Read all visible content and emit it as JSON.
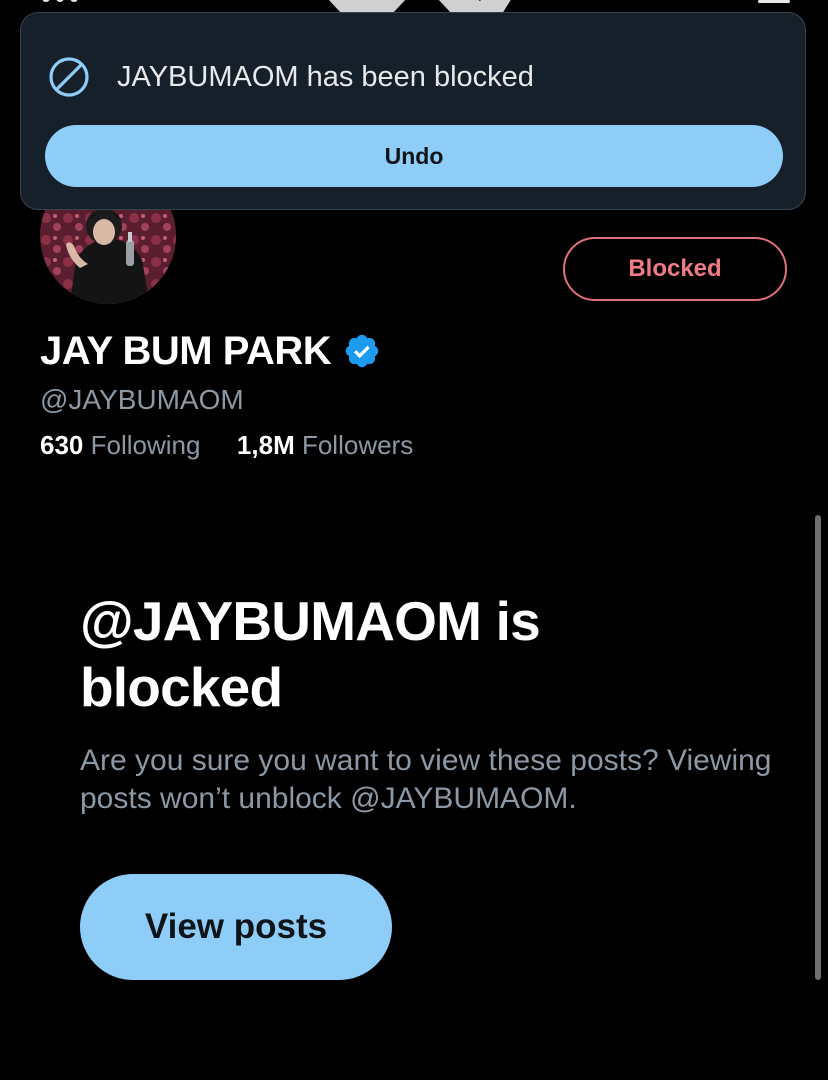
{
  "toast": {
    "icon": "block-icon",
    "message": "JAYBUMAOM has been blocked",
    "undo_label": "Undo"
  },
  "header": {
    "logo": "x-logo-icon",
    "menu_icon": "menu-icon"
  },
  "profile": {
    "avatar": "avatar",
    "blocked_button_label": "Blocked",
    "display_name": "JAY BUM PARK",
    "verified": true,
    "handle": "@JAYBUMAOM",
    "following_count": "630",
    "following_label": "Following",
    "followers_count": "1,8M",
    "followers_label": "Followers"
  },
  "blocked_notice": {
    "title": "@JAYBUMAOM is blocked",
    "description": "Are you sure you want to view these posts? Viewing posts won’t unblock @JAYBUMAOM.",
    "view_posts_label": "View posts"
  },
  "colors": {
    "background": "#000000",
    "toast_background": "#15202b",
    "accent_button": "#8ecdf8",
    "blocked_red": "#f07b84",
    "verified_blue": "#1d9bf0",
    "secondary_text": "#8b98a5"
  }
}
